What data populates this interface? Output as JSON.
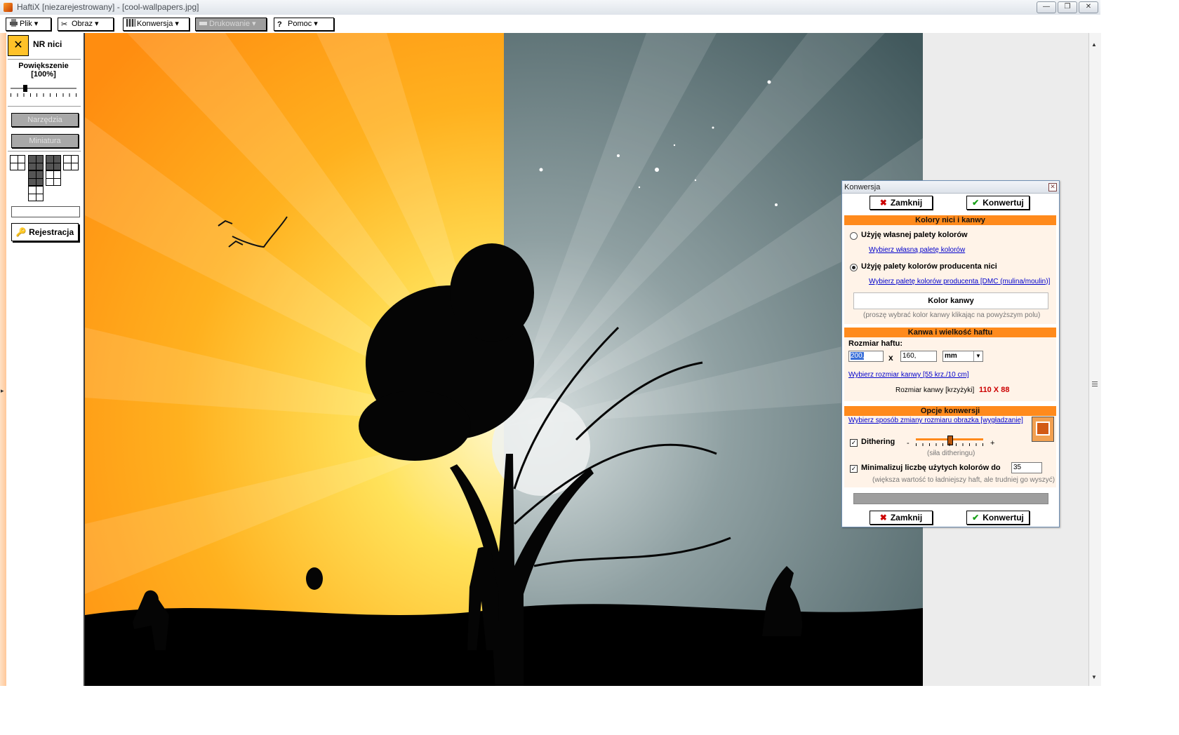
{
  "window": {
    "title": "HaftiX [niezarejestrowany] - [cool-wallpapers.jpg]",
    "controls": [
      "minimize",
      "restore",
      "close"
    ]
  },
  "toolbar": {
    "items": [
      {
        "label": "Plik",
        "icon": "printer-icon",
        "enabled": true
      },
      {
        "label": "Obraz",
        "icon": "scissors-icon",
        "enabled": true
      },
      {
        "label": "Konwersja",
        "icon": "grid-icon",
        "enabled": true
      },
      {
        "label": "Drukowanie",
        "icon": "printer-icon",
        "enabled": false
      },
      {
        "label": "Pomoc",
        "icon": "help-icon",
        "enabled": true
      }
    ]
  },
  "sidebar": {
    "nr_label": "NR nici",
    "zoom_label": "Powiększenie",
    "zoom_value": "[100%]",
    "zoom_level_fraction": 0.2,
    "tools_button": "Narzędzia",
    "thumbnail_button": "Miniatura",
    "register_button": "Rejestracja"
  },
  "dialog": {
    "title": "Konwersja",
    "close_label": "Zamknij",
    "convert_label": "Konwertuj",
    "colors": {
      "header": "Kolory nici i kanwy",
      "own_palette_option": "Użyję własnej palety kolorów",
      "own_palette_link": "Wybierz własną paletę kolorów",
      "producer_palette_option": "Użyję palety kolorów producenta nici",
      "producer_palette_link": "Wybierz paletę kolorów producenta [DMC (mulina/moulin)]",
      "selected": "producer",
      "canvas_color_label": "Kolor kanwy",
      "canvas_color_hint": "(proszę wybrać kolor kanwy klikając na powyższym polu)"
    },
    "canvas": {
      "header": "Kanwa i wielkość haftu",
      "size_label": "Rozmiar haftu:",
      "width_value": "200,",
      "height_value": "160,",
      "unit_value": "mm",
      "times": "x",
      "canvas_link": "Wybierz rozmiar kanwy [55 krz./10 cm]",
      "canvas_size_label": "Rozmiar kanwy [krzyżyki]",
      "canvas_size_value": "110 X 88"
    },
    "options": {
      "header": "Opcje konwersji",
      "resize_link": "Wybierz sposób zmiany rozmiaru obrazka [wygładzanie]",
      "dithering_label": "Dithering",
      "dithering_checked": true,
      "dithering_minus": "-",
      "dithering_plus": "+",
      "dithering_level_fraction": 0.5,
      "dithering_hint": "(siła ditheringu)",
      "minimize_label": "Minimalizuj liczbę użytych kolorów do",
      "minimize_checked": true,
      "minimize_value": "35",
      "minimize_hint": "(większa wartość to ładniejszy haft, ale trudniej go wyszyć)"
    },
    "progress_fraction": 0
  },
  "colors": {
    "accent": "#ff8a1c",
    "section_bg": "#fff3e8",
    "canvas_size_value": "#cc0000",
    "link": "#0000cc"
  }
}
